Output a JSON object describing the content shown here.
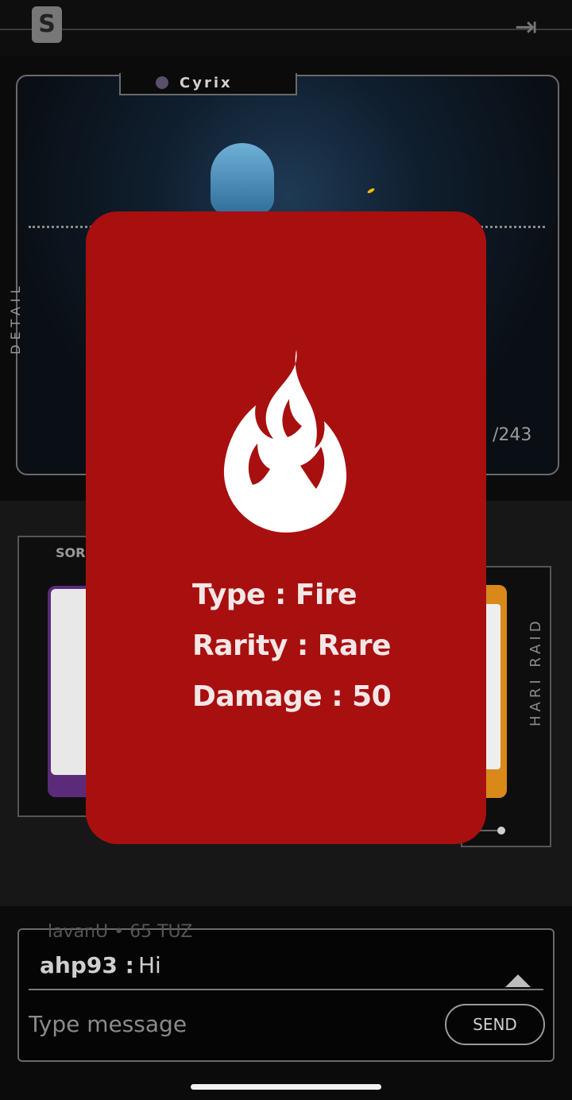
{
  "header": {
    "logo_icon": "s-logo-icon",
    "exit_icon": "exit-door-icon"
  },
  "hero": {
    "name": "Cyrix",
    "side_label": "DETAIL",
    "counter": "/243"
  },
  "cards": {
    "left_label": "SOR",
    "right_side_label": "HARI RAID"
  },
  "chat": {
    "ghost_line": "lavanU • 65 TUZ",
    "messages": [
      {
        "user": "ahp93 :",
        "text": "Hi"
      }
    ],
    "input_placeholder": "Type message",
    "send_label": "SEND"
  },
  "modal": {
    "icon": "fire-icon",
    "background_color": "#a80f0f",
    "stats": [
      {
        "label": "Type",
        "value": "Fire",
        "text": "Type : Fire"
      },
      {
        "label": "Rarity",
        "value": "Rare",
        "text": "Rarity : Rare"
      },
      {
        "label": "Damage",
        "value": "50",
        "text": "Damage : 50"
      }
    ]
  }
}
